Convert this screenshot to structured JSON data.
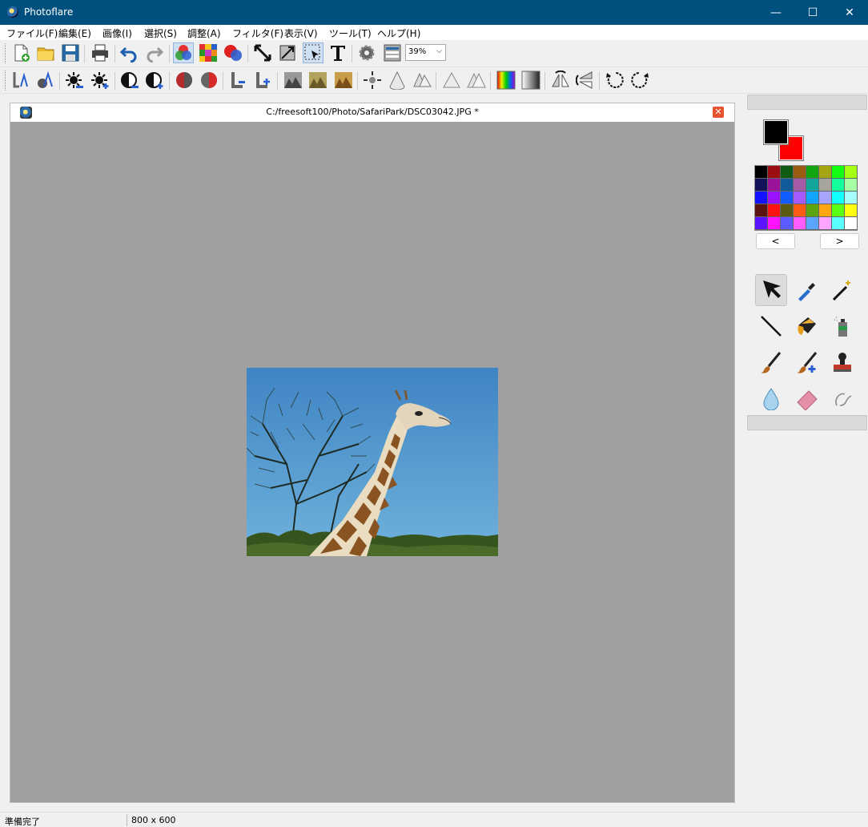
{
  "window": {
    "title": "Photoflare",
    "buttons": {
      "minimize": "—",
      "maximize": "☐",
      "close": "✕"
    }
  },
  "menu": [
    "ファイル(F)",
    "編集(E)",
    "画像(I)",
    "選択(S)",
    "調整(A)",
    "フィルタ(F)",
    "表示(V)",
    "ツール(T)",
    "ヘルプ(H)"
  ],
  "toolbar": {
    "zoom_value": "39%",
    "zoom_arrow": "⌵"
  },
  "document": {
    "path": "C:/freesoft100/Photo/SafariPark/DSC03042.JPG *",
    "close_glyph": "✕"
  },
  "palette": {
    "foreground": "#000000",
    "background": "#ff0000",
    "colors": [
      "#000000",
      "#9b0f12",
      "#0f5b12",
      "#9b5c12",
      "#12a512",
      "#a5a512",
      "#12ff12",
      "#a5ff12",
      "#12125b",
      "#9b129b",
      "#125b9b",
      "#a55ba5",
      "#12a59b",
      "#a5a59b",
      "#12ff9b",
      "#a5ffa5",
      "#1212ff",
      "#9b12ff",
      "#125bff",
      "#a55bff",
      "#12a5ff",
      "#a5a5ff",
      "#12ffff",
      "#a5ffff",
      "#5b1212",
      "#ff1212",
      "#5b5b12",
      "#ff5b12",
      "#5ba512",
      "#ffa512",
      "#5bff12",
      "#ffff12",
      "#5b12ff",
      "#ff12ff",
      "#5b5bff",
      "#ff5bff",
      "#5ba5ff",
      "#ffa5ff",
      "#5bffff",
      "#ffffff"
    ],
    "prev_label": "<",
    "next_label": ">"
  },
  "status": {
    "message": "準備完了",
    "dimensions": "800 x 600"
  }
}
